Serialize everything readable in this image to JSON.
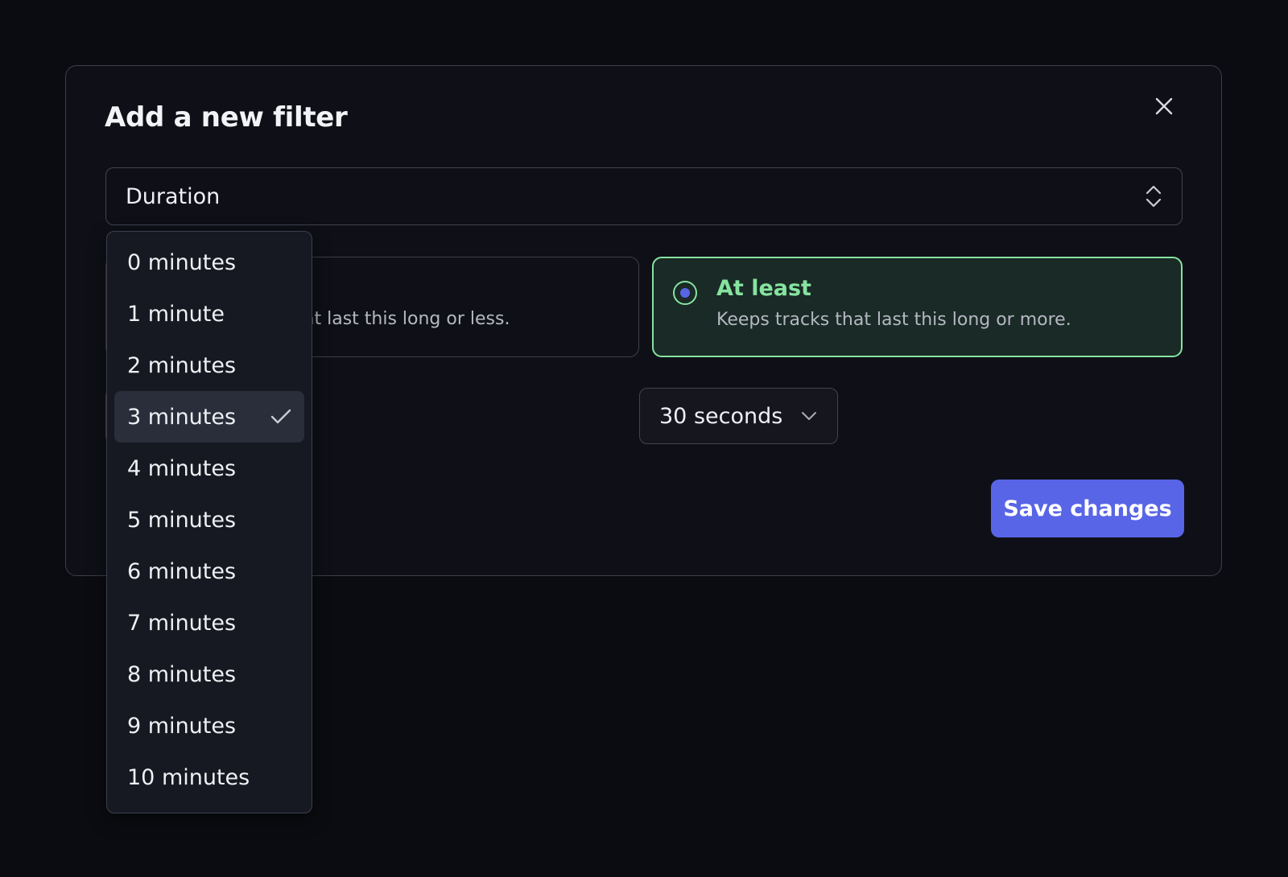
{
  "dialog": {
    "title": "Add a new filter",
    "close_icon": "close-icon"
  },
  "field_select": {
    "value": "Duration",
    "icon": "chevron-up-down-icon"
  },
  "options": {
    "at_most": {
      "title": "",
      "description": "at last this long or less.",
      "selected": false
    },
    "at_least": {
      "title": "At least",
      "description": "Keeps tracks that last this long or more.",
      "selected": true
    }
  },
  "minutes_select": {
    "options": [
      "0 minutes",
      "1 minute",
      "2 minutes",
      "3 minutes",
      "4 minutes",
      "5 minutes",
      "6 minutes",
      "7 minutes",
      "8 minutes",
      "9 minutes",
      "10 minutes"
    ],
    "selected": "3 minutes",
    "check_icon": "check-icon"
  },
  "seconds_select": {
    "value": "30 seconds",
    "icon": "chevron-down-icon"
  },
  "save_button": {
    "label": "Save changes"
  },
  "colors": {
    "background": "#0b0c11",
    "accent": "#5865e6",
    "success": "#86e3a0"
  }
}
